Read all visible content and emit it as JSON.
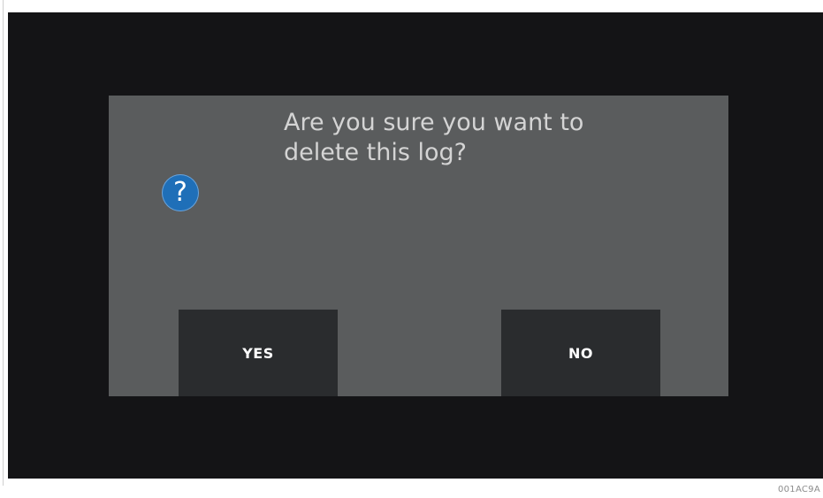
{
  "dialog": {
    "icon": "question-icon",
    "icon_glyph": "?",
    "message_line1": "Are you sure you want to",
    "message_line2": "delete this log?",
    "yes_label": "YES",
    "no_label": "NO"
  },
  "figure_code": "001AC9A",
  "colors": {
    "screen_background": "#141416",
    "dialog_background": "#5a5c5d",
    "button_background": "#2a2c2e",
    "icon_blue": "#1f6fb8",
    "message_text": "#d4d4d4"
  }
}
